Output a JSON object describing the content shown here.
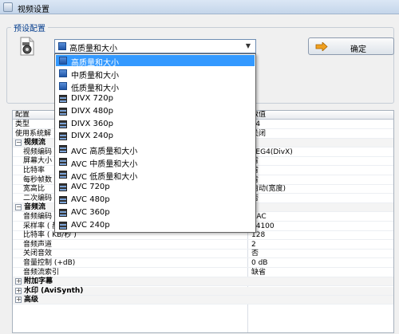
{
  "window": {
    "title": "视频设置"
  },
  "preset": {
    "group_label": "预设配置",
    "selected": "高质量和大小",
    "ok_label": "确定",
    "options": [
      {
        "label": "高质量和大小",
        "icon": "quality-icon",
        "selected": true
      },
      {
        "label": "中质量和大小",
        "icon": "quality-icon"
      },
      {
        "label": "低质量和大小",
        "icon": "quality-icon"
      },
      {
        "label": "DIVX 720p",
        "icon": "film-icon"
      },
      {
        "label": "DIVX 480p",
        "icon": "film-icon"
      },
      {
        "label": "DIVX 360p",
        "icon": "film-icon"
      },
      {
        "label": "DIVX 240p",
        "icon": "film-icon"
      },
      {
        "label": "AVC 高质量和大小",
        "icon": "film-icon"
      },
      {
        "label": "AVC 中质量和大小",
        "icon": "film-icon"
      },
      {
        "label": "AVC 低质量和大小",
        "icon": "film-icon"
      },
      {
        "label": "AVC 720p",
        "icon": "film-icon"
      },
      {
        "label": "AVC 480p",
        "icon": "film-icon"
      },
      {
        "label": "AVC 360p",
        "icon": "film-icon"
      },
      {
        "label": "AVC 240p",
        "icon": "film-icon"
      }
    ]
  },
  "grid": {
    "header": {
      "name": "配置",
      "value": "数值"
    },
    "rows": [
      {
        "type": "item",
        "name": "类型",
        "value": "P4"
      },
      {
        "type": "item",
        "name": "使用系统解",
        "value": "关闭"
      },
      {
        "type": "category",
        "name": "视频流",
        "toggle": "−"
      },
      {
        "type": "child",
        "name": "视频编码",
        "value": "PEG4(DivX)"
      },
      {
        "type": "child",
        "name": "屏幕大小",
        "value": "省"
      },
      {
        "type": "child",
        "name": "比特率",
        "value": "省"
      },
      {
        "type": "child",
        "name": "每秒帧数",
        "value": "省"
      },
      {
        "type": "child",
        "name": "宽高比",
        "value": "自动(宽度)"
      },
      {
        "type": "child",
        "name": "二次编码",
        "value": "否"
      },
      {
        "type": "category",
        "name": "音频流",
        "toggle": "−"
      },
      {
        "type": "child",
        "name": "音频编码",
        "value": "AAC"
      },
      {
        "type": "child",
        "name": "采样率 ( 赫兹 )",
        "value": "44100"
      },
      {
        "type": "child",
        "name": "比特率 ( KB/秒 )",
        "value": "128"
      },
      {
        "type": "child",
        "name": "音频声道",
        "value": "2"
      },
      {
        "type": "child",
        "name": "关闭音效",
        "value": "否"
      },
      {
        "type": "child",
        "name": "音量控制 (+dB)",
        "value": "0 dB"
      },
      {
        "type": "child",
        "name": "音频流索引",
        "value": "缺省"
      },
      {
        "type": "category",
        "name": "附加字幕",
        "toggle": "+"
      },
      {
        "type": "category",
        "name": "水印 (AviSynth)",
        "toggle": "+"
      },
      {
        "type": "category",
        "name": "高级",
        "toggle": "+"
      }
    ]
  }
}
